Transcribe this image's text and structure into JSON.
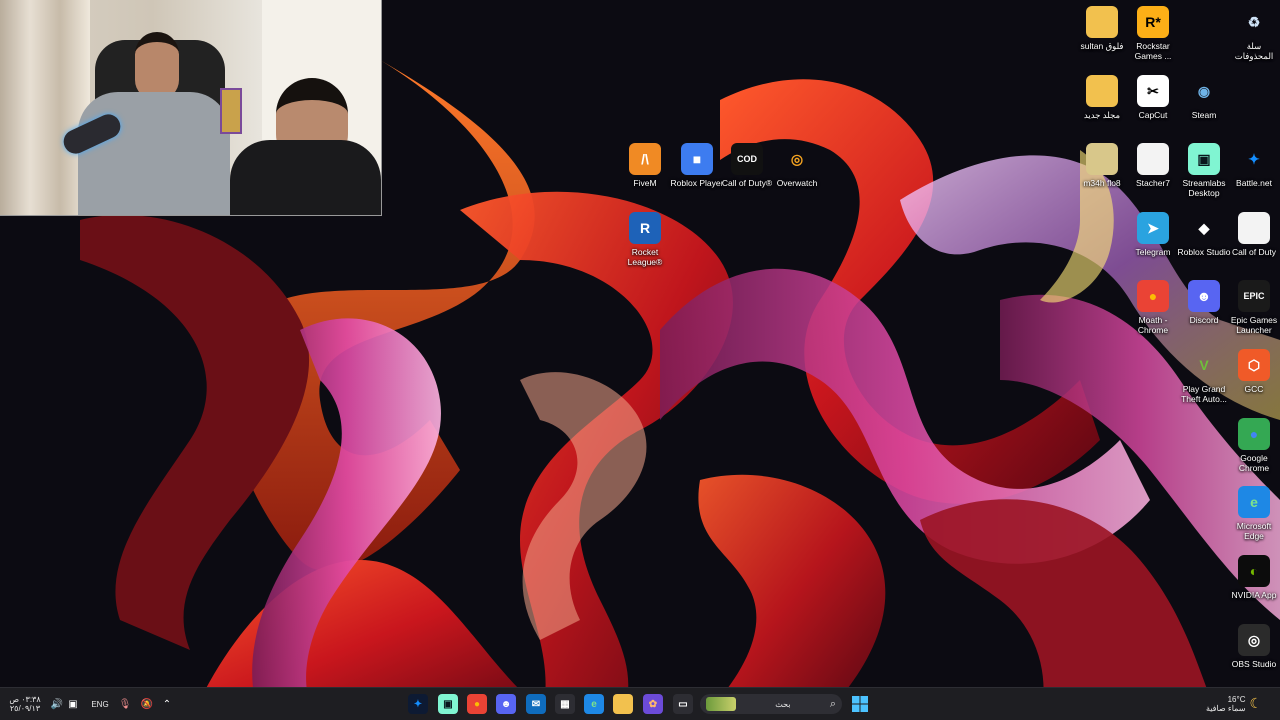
{
  "desktop_icons": [
    {
      "name": "icon-rocket-league",
      "label": "Rocket League®",
      "glyph": "R",
      "bg": "#1e62b8",
      "fg": "#ffffff"
    },
    {
      "name": "icon-fivem",
      "label": "FiveM",
      "glyph": "/\\",
      "bg": "#f08a24",
      "fg": "#ffffff"
    },
    {
      "name": "icon-roblox-player",
      "label": "Roblox Player",
      "glyph": "■",
      "bg": "#3d7cf0",
      "fg": "#ffffff"
    },
    {
      "name": "icon-call-of-duty-game",
      "label": "Call of Duty®",
      "glyph": "COD",
      "bg": "#111111",
      "fg": "#ffffff"
    },
    {
      "name": "icon-overwatch",
      "label": "Overwatch",
      "glyph": "◎",
      "bg": "transparent",
      "fg": "#f4a321"
    },
    {
      "name": "icon-folder-sultan",
      "label": "sultan فلوق",
      "glyph": "",
      "bg": "#f2c14e",
      "fg": "#ffffff"
    },
    {
      "name": "icon-rockstar",
      "label": "Rockstar Games ...",
      "glyph": "R*",
      "bg": "#fcaf17",
      "fg": "#000000"
    },
    {
      "name": "icon-recycle-bin",
      "label": "سلة المحذوفات",
      "glyph": "♻",
      "bg": "transparent",
      "fg": "#cfe3f7"
    },
    {
      "name": "icon-new-folder",
      "label": "مجلد جديد",
      "glyph": "",
      "bg": "#f2c14e",
      "fg": "#ffffff"
    },
    {
      "name": "icon-capcut",
      "label": "CapCut",
      "glyph": "✂",
      "bg": "#ffffff",
      "fg": "#000000"
    },
    {
      "name": "icon-steam",
      "label": "Steam",
      "glyph": "◉",
      "bg": "transparent",
      "fg": "#6fb4e8"
    },
    {
      "name": "icon-folder-m34h",
      "label": "m34h flo8",
      "glyph": "",
      "bg": "#d8c78a",
      "fg": "#ffffff"
    },
    {
      "name": "icon-stacher",
      "label": "Stacher7",
      "glyph": "",
      "bg": "#f3f3f3",
      "fg": "#333333"
    },
    {
      "name": "icon-streamlabs",
      "label": "Streamlabs Desktop",
      "glyph": "▣",
      "bg": "#80f5d2",
      "fg": "#09161d"
    },
    {
      "name": "icon-battlenet",
      "label": "Battle.net",
      "glyph": "✦",
      "bg": "transparent",
      "fg": "#148eff"
    },
    {
      "name": "icon-telegram",
      "label": "Telegram",
      "glyph": "➤",
      "bg": "#2aa3e0",
      "fg": "#ffffff"
    },
    {
      "name": "icon-roblox-studio",
      "label": "Roblox Studio",
      "glyph": "◆",
      "bg": "transparent",
      "fg": "#ffffff"
    },
    {
      "name": "icon-cod-shortcut",
      "label": "Call of Duty",
      "glyph": "",
      "bg": "#f3f3f3",
      "fg": "#333333"
    },
    {
      "name": "icon-chrome-moath",
      "label": "Moath - Chrome",
      "glyph": "●",
      "bg": "#ea4335",
      "fg": "#fbbc04"
    },
    {
      "name": "icon-discord",
      "label": "Discord",
      "glyph": "☻",
      "bg": "#5865f2",
      "fg": "#ffffff"
    },
    {
      "name": "icon-epic-games",
      "label": "Epic Games Launcher",
      "glyph": "EPIC",
      "bg": "#1a1a1a",
      "fg": "#ffffff"
    },
    {
      "name": "icon-gta",
      "label": "Play Grand Theft Auto...",
      "glyph": "V",
      "bg": "transparent",
      "fg": "#6fbf3a"
    },
    {
      "name": "icon-gcc",
      "label": "GCC",
      "glyph": "⬡",
      "bg": "#f05a28",
      "fg": "#ffffff"
    },
    {
      "name": "icon-google-chrome",
      "label": "Google Chrome",
      "glyph": "●",
      "bg": "#34a853",
      "fg": "#4285f4"
    },
    {
      "name": "icon-edge",
      "label": "Microsoft Edge",
      "glyph": "e",
      "bg": "#1e88e5",
      "fg": "#7ee38a"
    },
    {
      "name": "icon-nvidia",
      "label": "NVIDIA App",
      "glyph": "◐",
      "bg": "#0c0c0c",
      "fg": "#76b900"
    },
    {
      "name": "icon-obs",
      "label": "OBS Studio",
      "glyph": "◎",
      "bg": "#2b2b2b",
      "fg": "#ffffff"
    }
  ],
  "taskbar": {
    "search_placeholder": "بحث",
    "weather_temp": "16°C",
    "weather_desc": "سماء صافية",
    "lang": "ENG",
    "time": "٠٣:٣٨ ص",
    "date": "٢٥/٠٩/١٣",
    "apps": [
      {
        "name": "taskbar-battlenet",
        "glyph": "✦",
        "bg": "#0d1a33",
        "fg": "#148eff"
      },
      {
        "name": "taskbar-streamlabs",
        "glyph": "▣",
        "bg": "#80f5d2",
        "fg": "#09161d"
      },
      {
        "name": "taskbar-chrome",
        "glyph": "●",
        "bg": "#ea4335",
        "fg": "#fbbc04"
      },
      {
        "name": "taskbar-discord",
        "glyph": "☻",
        "bg": "#5865f2",
        "fg": "#ffffff"
      },
      {
        "name": "taskbar-outlook",
        "glyph": "✉",
        "bg": "#0f6cbd",
        "fg": "#ffffff"
      },
      {
        "name": "taskbar-store",
        "glyph": "▦",
        "bg": "#2d2d33",
        "fg": "#ffffff"
      },
      {
        "name": "taskbar-edge",
        "glyph": "e",
        "bg": "#1e88e5",
        "fg": "#7ee38a"
      },
      {
        "name": "taskbar-explorer",
        "glyph": "▬",
        "bg": "#f2c14e",
        "fg": "#f2c14e"
      },
      {
        "name": "taskbar-copilot",
        "glyph": "✿",
        "bg": "#6c4bd8",
        "fg": "#ffb86b"
      },
      {
        "name": "taskbar-taskview",
        "glyph": "▭",
        "bg": "#2d2d33",
        "fg": "#ffffff"
      }
    ]
  }
}
